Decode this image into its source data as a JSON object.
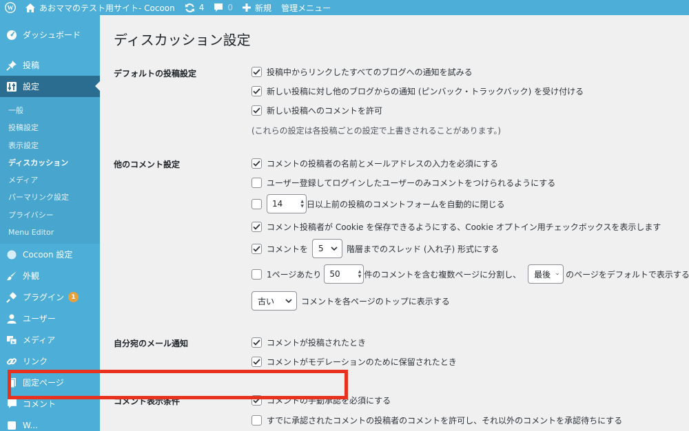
{
  "adminbar": {
    "site_name": "あおママのテスト用サイト- Cocoon",
    "updates_count": "4",
    "comments_count": "0",
    "new_label": "新規",
    "admin_menu_label": "管理メニュー"
  },
  "sidebar": {
    "dashboard": "ダッシュボード",
    "posts": "投稿",
    "settings": "設定",
    "submenu": [
      "一般",
      "投稿設定",
      "表示設定",
      "ディスカッション",
      "メディア",
      "パーマリンク設定",
      "プライバシー",
      "Menu Editor"
    ],
    "cocoon": "Cocoon 設定",
    "appearance": "外観",
    "plugins": "プラグイン",
    "plugins_badge": "1",
    "users": "ユーザー",
    "media": "メディア",
    "links": "リンク",
    "pages": "固定ページ",
    "comments": "コメント",
    "partial": "W..."
  },
  "main": {
    "title": "ディスカッション設定",
    "default_post_settings": {
      "label": "デフォルトの投稿設定",
      "opt1": "投稿中からリンクしたすべてのブログへの通知を試みる",
      "opt2": "新しい投稿に対し他のブログからの通知 (ピンバック・トラックバック) を受け付ける",
      "opt3": "新しい投稿へのコメントを許可",
      "note": "(これらの設定は各投稿ごとの設定で上書きされることがあります。)"
    },
    "other_comment_settings": {
      "label": "他のコメント設定",
      "require_name": "コメントの投稿者の名前とメールアドレスの入力を必須にする",
      "registered_only": "ユーザー登録してログインしたユーザーのみコメントをつけられるようにする",
      "close_days_value": "14",
      "close_days_text": "日以上前の投稿のコメントフォームを自動的に閉じる",
      "cookie_opt": "コメント投稿者が Cookie を保存できるようにする、Cookie オプトイン用チェックボックスを表示します",
      "thread_prefix": "コメントを",
      "thread_value": "5",
      "thread_suffix": "階層までのスレッド (入れ子) 形式にする",
      "page_prefix": "1ページあたり",
      "page_value": "50",
      "page_mid": "件のコメントを含む複数ページに分割し、",
      "page_select": "最後",
      "page_suffix": "のページをデフォルトで表示する",
      "order_select": "古い",
      "order_suffix": "コメントを各ページのトップに表示する"
    },
    "email_me": {
      "label": "自分宛のメール通知",
      "opt1": "コメントが投稿されたとき",
      "opt2": "コメントがモデレーションのために保留されたとき"
    },
    "comment_display": {
      "label": "コメント表示条件",
      "opt1": "コメントの手動承認を必須にする",
      "opt2": "すでに承認されたコメントの投稿者のコメントを許可し、それ以外のコメントを承認待ちにする"
    }
  },
  "colors": {
    "sidebar": "#4daed8",
    "current_menu": "#2a6d90",
    "highlight": "#e8321e"
  }
}
